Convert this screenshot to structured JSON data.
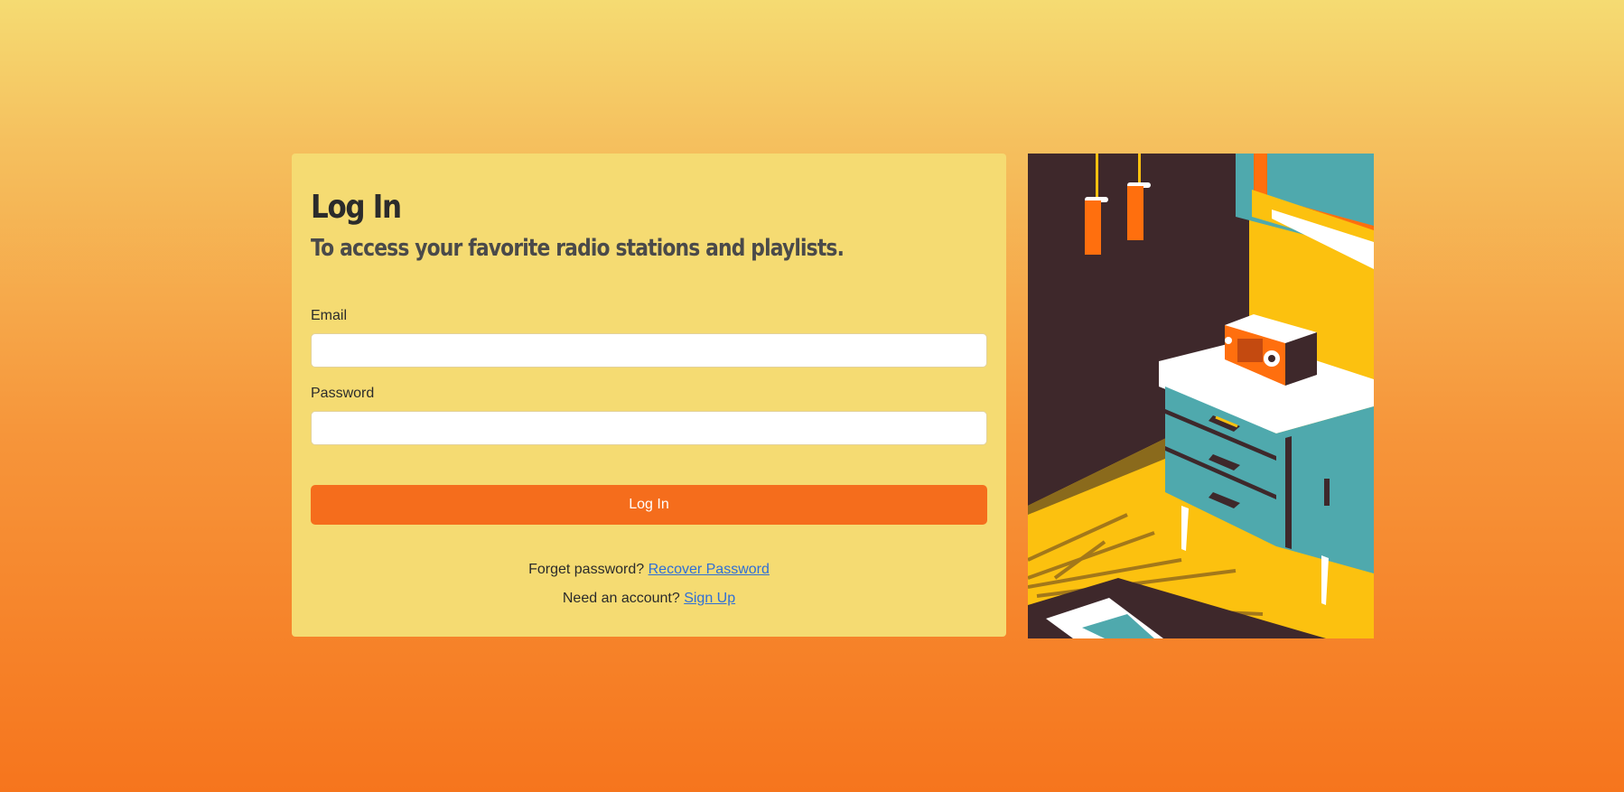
{
  "login": {
    "title": "Log In",
    "subtitle": "To access your favorite radio stations and playlists.",
    "email_label": "Email",
    "email_value": "",
    "password_label": "Password",
    "password_value": "",
    "submit_label": "Log In",
    "forgot_text": "Forget password?",
    "recover_link": "Recover Password",
    "signup_text": "Need an account?",
    "signup_link": "Sign Up"
  },
  "colors": {
    "background_top": "#f5db72",
    "background_bottom": "#f6751d",
    "card": "#f5db72",
    "button": "#f56d1c",
    "link": "#2f6fd6"
  }
}
